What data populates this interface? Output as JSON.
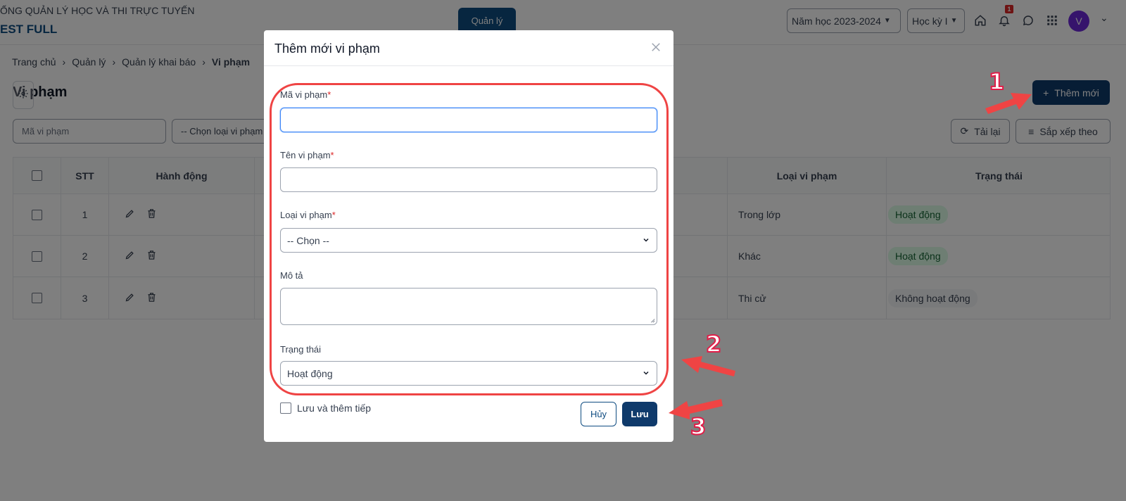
{
  "header": {
    "system_title": "ỐNG QUẢN LÝ HỌC VÀ THI TRỰC TUYẾN",
    "school_name": "EST FULL",
    "nav_manage": "Quản lý",
    "school_year": "Năm học 2023-2024",
    "semester": "Học kỳ I",
    "notification_count": "1",
    "avatar_initial": "V"
  },
  "breadcrumb": {
    "home": "Trang chủ",
    "manage": "Quản lý",
    "declaration": "Quản lý khai báo",
    "current": "Vi phạm"
  },
  "page": {
    "title": "Vi phạm",
    "add_button": "Thêm mới",
    "filter_code_placeholder": "Mã vi phạm",
    "filter_type": "-- Chọn loại vi phạm --",
    "reload_button": "Tải lại",
    "sort_button": "Sắp xếp theo"
  },
  "table": {
    "headers": {
      "stt": "STT",
      "actions": "Hành động",
      "type": "Loại vi phạm",
      "status": "Trạng thái"
    },
    "rows": [
      {
        "stt": "1",
        "type": "Trong lớp",
        "status": "Hoạt động",
        "status_kind": "active"
      },
      {
        "stt": "2",
        "type": "Khác",
        "status": "Hoạt động",
        "status_kind": "active"
      },
      {
        "stt": "3",
        "type": "Thi cử",
        "status": "Không hoạt động",
        "status_kind": "inactive"
      }
    ]
  },
  "modal": {
    "title": "Thêm mới vi phạm",
    "fields": {
      "code_label": "Mã vi phạm",
      "code_value": "",
      "name_label": "Tên vi phạm",
      "name_value": "",
      "type_label": "Loại vi phạm",
      "type_value": "-- Chọn --",
      "description_label": "Mô tả",
      "description_value": "",
      "status_label": "Trạng thái",
      "status_value": "Hoạt động"
    },
    "required_mark": "*",
    "save_continue_label": "Lưu và thêm tiếp",
    "cancel_button": "Hủy",
    "save_button": "Lưu"
  },
  "annotations": {
    "step1": "1",
    "step2": "2",
    "step3": "3",
    "color": "#ef4444"
  },
  "colors": {
    "primary": "#0f3a6b",
    "active_badge_bg": "#dcfce7",
    "active_badge_text": "#166534",
    "avatar": "#6d28d9"
  }
}
